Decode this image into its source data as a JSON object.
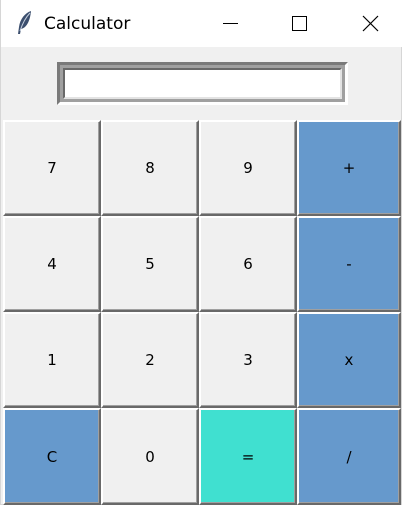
{
  "window": {
    "title": "Calculator"
  },
  "display": {
    "value": ""
  },
  "keys": {
    "seven": "7",
    "eight": "8",
    "nine": "9",
    "plus": "+",
    "four": "4",
    "five": "5",
    "six": "6",
    "minus": "-",
    "one": "1",
    "two": "2",
    "three": "3",
    "multiply": "x",
    "clear": "C",
    "zero": "0",
    "equals": "=",
    "divide": "/"
  },
  "colors": {
    "operator_key": "#6699cc",
    "equals_key": "#40e0d0",
    "digit_key": "#f0f0f0"
  },
  "icons": {
    "app": "feather-icon",
    "minimize": "minimize-icon",
    "maximize": "maximize-icon",
    "close": "close-icon"
  }
}
